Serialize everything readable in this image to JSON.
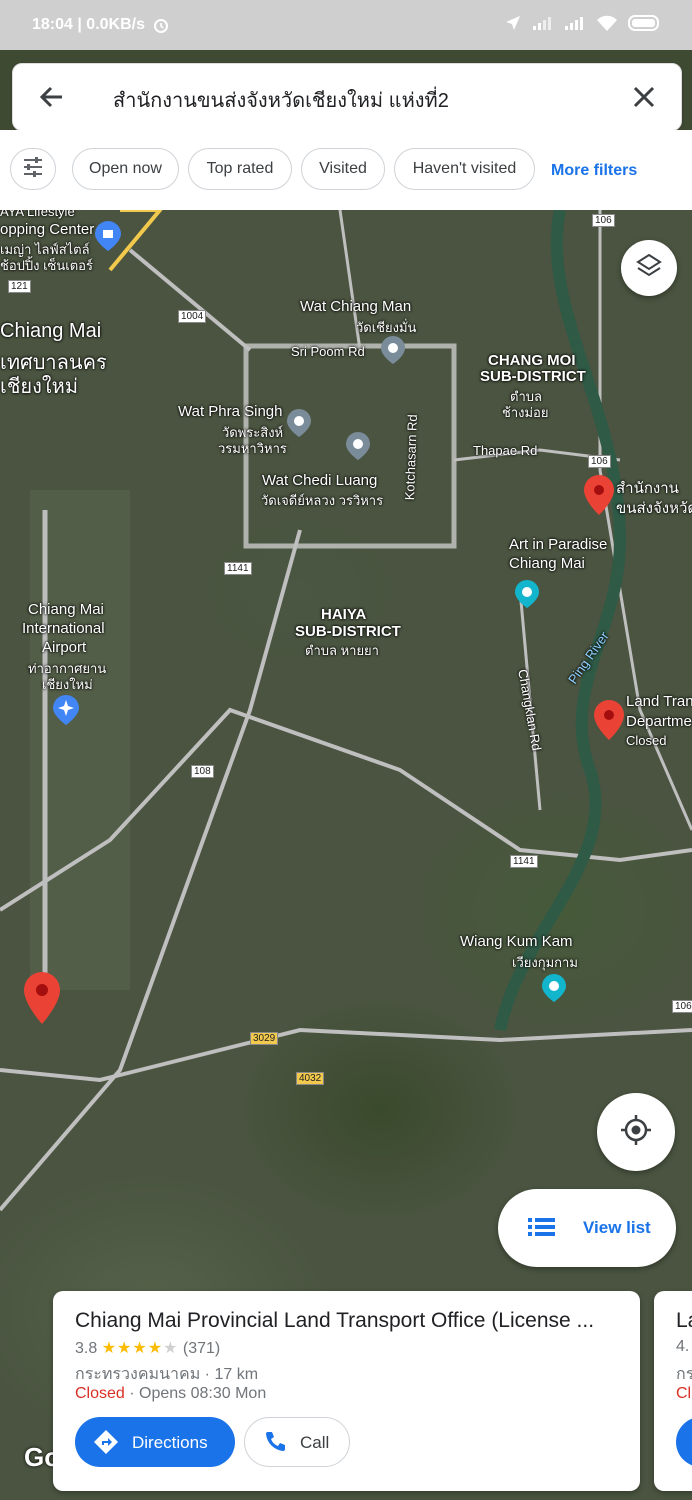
{
  "status_bar": {
    "left": "18:04 | 0.0KB/s"
  },
  "search": {
    "query": "สำนักงานขนส่งจังหวัดเชียงใหม่ แห่งที่2"
  },
  "filters": {
    "chips": [
      "Open now",
      "Top rated",
      "Visited",
      "Haven't visited"
    ],
    "more": "More filters"
  },
  "map": {
    "labels": {
      "aya_1": "AYA Lifestyle",
      "aya_2": "opping Center",
      "aya_3": "เมญ่า ไลฟ์สไตล์",
      "aya_4": "ช้อปปิ้ง เซ็นเตอร์",
      "wat_chiang_man": "Wat Chiang Man",
      "wat_chiang_man_th": "วัดเชียงมั่น",
      "sri_poom": "Sri Poom Rd",
      "chang_moi_1": "CHANG MOI",
      "chang_moi_2": "SUB-DISTRICT",
      "chang_moi_3": "ตำบล",
      "chang_moi_4": "ช้างม่อย",
      "chiang_mai": "Chiang Mai",
      "chiang_mai_th1": "เทศบาลนคร",
      "chiang_mai_th2": "เชียงใหม่",
      "wat_phra_singh": "Wat Phra Singh",
      "wat_phra_singh_th1": "วัดพระสิงห์",
      "wat_phra_singh_th2": "วรมหาวิหาร",
      "thapae": "Thapae Rd",
      "wat_chedi": "Wat Chedi Luang",
      "wat_chedi_th": "วัดเจดีย์หลวง วรวิหาร",
      "office_1": "สำนักงาน",
      "office_2": "ขนส่งจังหวัด",
      "kotchasarn": "Kotchasarn Rd",
      "art_1": "Art in Paradise",
      "art_2": "Chiang Mai",
      "airport_1": "Chiang Mai",
      "airport_2": "International",
      "airport_3": "Airport",
      "airport_4": "ท่าอากาศยาน",
      "airport_5": "เชียงใหม่",
      "haiya_1": "HAIYA",
      "haiya_2": "SUB-DISTRICT",
      "haiya_3": "ตำบล หายยา",
      "ping_river": "Ping River",
      "changklan": "Changklan Rd",
      "land_1": "Land Tran",
      "land_2": "Departme",
      "land_3": "Closed",
      "wiang_1": "Wiang Kum Kam",
      "wiang_2": "เวียงกุมกาม"
    },
    "road_numbers": {
      "r106a": "106",
      "r121": "121",
      "r1004": "1004",
      "r106b": "106",
      "r1141a": "1141",
      "r108": "108",
      "r1141b": "1141",
      "r106c": "106",
      "r3029": "3029",
      "r4032": "4032"
    },
    "attribution": "Google"
  },
  "view_list": {
    "label": "View list"
  },
  "place_card": {
    "title": "Chiang Mai Provincial Land Transport Office (License ...",
    "rating": "3.8",
    "rating_value": 3.8,
    "stars": "★★★★",
    "star_empty": "★",
    "reviews": "(371)",
    "category": "กระทรวงคมนาคม · 17 km",
    "closed": "Closed",
    "opens": " · Opens 08:30 Mon",
    "directions": "Directions",
    "call": "Call"
  },
  "next_card": {
    "title": "La",
    "rating": "4.",
    "line3": "กร",
    "line4": "Cl"
  },
  "colors": {
    "accent": "#1a73e8",
    "closed": "#d93025",
    "star": "#fbbc04",
    "pin": "#ea4335"
  }
}
